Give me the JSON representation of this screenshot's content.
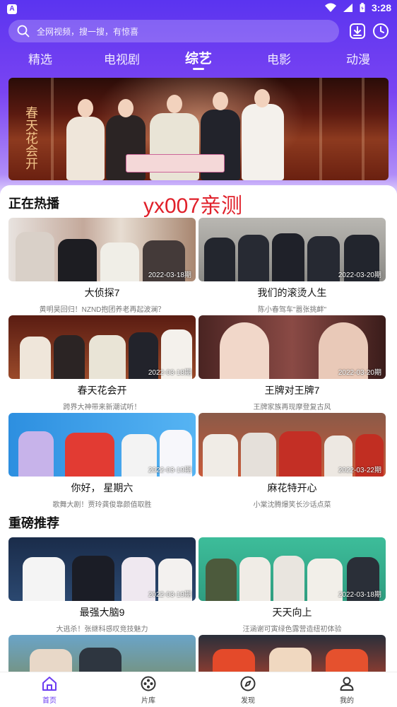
{
  "status_bar": {
    "time": "3:28",
    "app_badge": "A"
  },
  "search": {
    "placeholder": "全网视频，搜一搜，有惊喜"
  },
  "tabs": [
    {
      "label": "精选"
    },
    {
      "label": "电视剧"
    },
    {
      "label": "综艺",
      "active": true
    },
    {
      "label": "电影"
    },
    {
      "label": "动漫"
    }
  ],
  "banner": {
    "calligraphy": "春天花会开"
  },
  "watermark": "yx007亲测",
  "sections": [
    {
      "title": "正在热播",
      "items": [
        {
          "title": "大侦探7",
          "subtitle": "黄明昊回归！NZND抱团养老再起波澜？",
          "date": "2022-03-18期"
        },
        {
          "title": "我们的滚烫人生",
          "subtitle": "陈小春驾车\"嚣张挑衅\"",
          "date": "2022-03-20期"
        },
        {
          "title": "春天花会开",
          "subtitle": "跨界大神带来新潮试听！",
          "date": "2022-03-18期"
        },
        {
          "title": "王牌对王牌7",
          "subtitle": "王牌家族再现摩登复古风",
          "date": "2022-03-20期"
        },
        {
          "title": "你好， 星期六",
          "subtitle": "歌舞大剧！贾玲龚俊靠颜值取胜",
          "date": "2022-03-19期"
        },
        {
          "title": "麻花特开心",
          "subtitle": "小棠沈腾爆笑长沙话点菜",
          "date": "2022-03-22期"
        }
      ]
    },
    {
      "title": "重磅推荐",
      "items": [
        {
          "title": "最强大脑9",
          "subtitle": "大逃杀！张继科感叹竞技魅力",
          "date": "2022-03-19期"
        },
        {
          "title": "天天向上",
          "subtitle": "汪涵谢可寅绿色露营造纽初体验",
          "date": "2022-03-18期"
        }
      ]
    }
  ],
  "bottom_nav": [
    {
      "label": "首页",
      "icon": "home-icon",
      "active": true
    },
    {
      "label": "片库",
      "icon": "film-reel-icon"
    },
    {
      "label": "发现",
      "icon": "compass-icon"
    },
    {
      "label": "我的",
      "icon": "user-icon"
    }
  ],
  "colors": {
    "accent": "#6b3cf1",
    "watermark": "#e0202a"
  }
}
